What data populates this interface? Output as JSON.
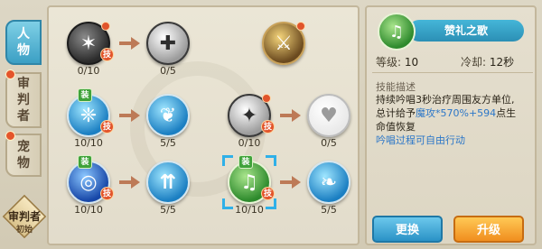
{
  "tabs": [
    {
      "label": "人物",
      "active": true,
      "notif": false
    },
    {
      "label": "审判者",
      "active": false,
      "notif": true
    },
    {
      "label": "宠物",
      "active": false,
      "notif": true
    }
  ],
  "badge": {
    "title": "审判者",
    "subtitle": "初始"
  },
  "skill_tree": {
    "rows": [
      {
        "nodes": [
          {
            "icon": "dark-skill-icon",
            "count": "0/10",
            "badges": [
              "dot",
              "技"
            ]
          },
          {
            "icon": "plus-shield-icon",
            "count": "0/5",
            "badges": []
          },
          {
            "icon": "golden-sword-icon",
            "count": "",
            "badges": [
              "dot"
            ]
          }
        ]
      },
      {
        "nodes": [
          {
            "icon": "blue-phoenix-icon",
            "count": "10/10",
            "badges": [
              "装",
              "技"
            ]
          },
          {
            "icon": "wings-icon",
            "count": "5/5",
            "badges": []
          },
          {
            "icon": "grayed-skill-icon",
            "count": "0/10",
            "badges": [
              "dot",
              "技"
            ]
          },
          {
            "icon": "heart-icon",
            "count": "0/5",
            "badges": []
          }
        ]
      },
      {
        "nodes": [
          {
            "icon": "water-vortex-icon",
            "count": "10/10",
            "badges": [
              "装",
              "技"
            ]
          },
          {
            "icon": "triple-arrow-icon",
            "count": "5/5",
            "badges": []
          },
          {
            "icon": "harp-icon",
            "count": "10/10",
            "badges": [
              "装",
              "技"
            ],
            "selected": true
          },
          {
            "icon": "feather-icon",
            "count": "5/5",
            "badges": []
          }
        ]
      }
    ]
  },
  "detail": {
    "skill_name": "赞礼之歌",
    "level_label": "等级:",
    "level_value": "10",
    "cooldown_label": "冷却:",
    "cooldown_value": "12秒",
    "desc_title": "技能描述",
    "desc_line1": "持续吟唱3秒治疗周围友方单位,",
    "desc_line2_pre": "总计给予",
    "desc_line2_hl": "魔攻*570%+594",
    "desc_line2_post": "点生",
    "desc_line3": "命值恢复",
    "desc_line4": "吟唱过程可自由行动"
  },
  "buttons": {
    "swap": "更换",
    "upgrade": "升级"
  },
  "colors": {
    "accent_blue": "#2c77c8",
    "upgrade_orange": "#f08e1f",
    "swap_blue": "#2a92c6",
    "notif_red": "#e0542b"
  }
}
